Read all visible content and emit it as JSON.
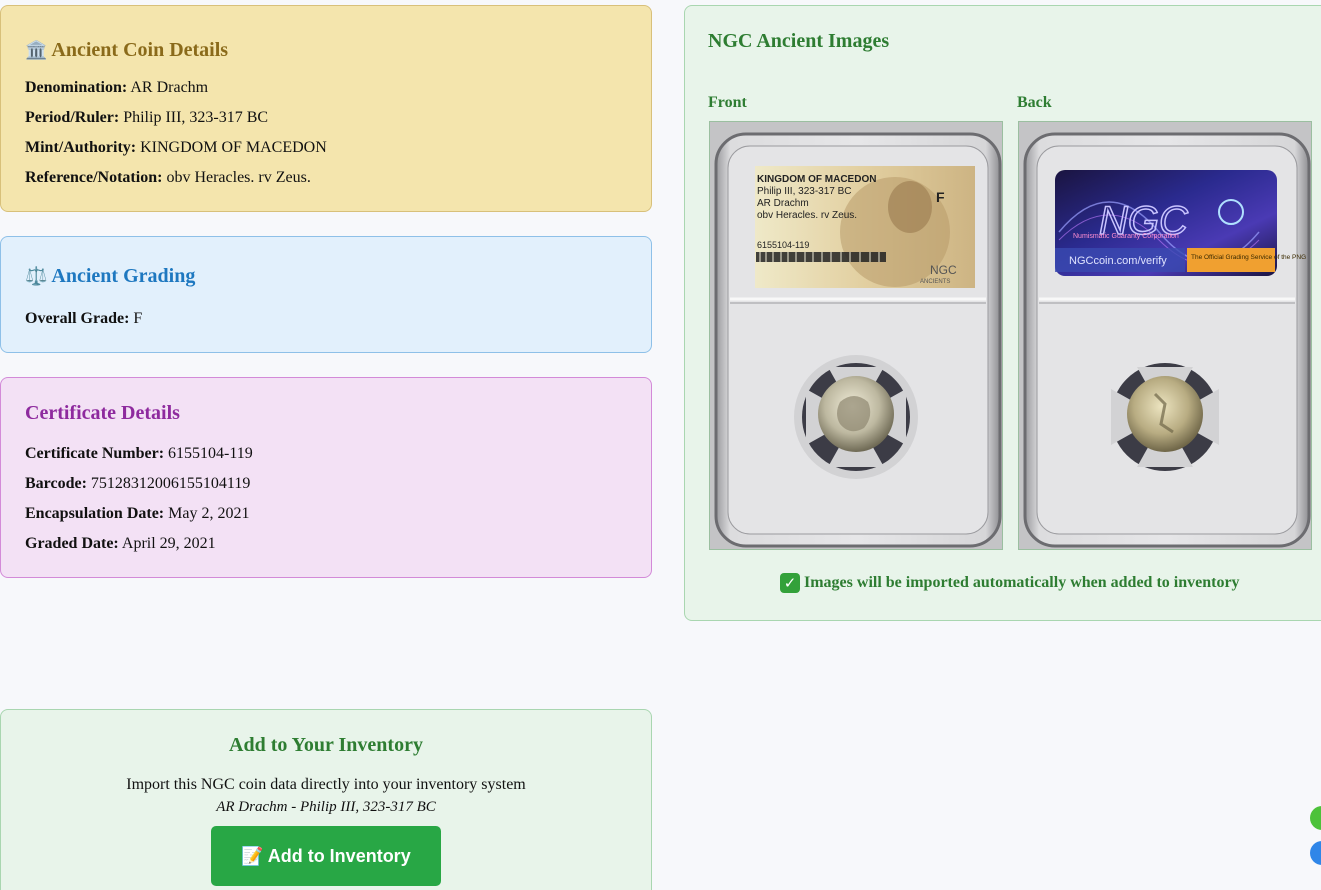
{
  "coin_details": {
    "icon": "classical-building-icon",
    "icon_glyph": "🏛️",
    "title": "Ancient Coin Details",
    "rows": [
      {
        "label": "Denomination:",
        "value": "AR Drachm"
      },
      {
        "label": "Period/Ruler:",
        "value": "Philip III, 323-317 BC"
      },
      {
        "label": "Mint/Authority:",
        "value": "KINGDOM OF MACEDON"
      },
      {
        "label": "Reference/Notation:",
        "value": "obv Heracles. rv Zeus."
      }
    ]
  },
  "grading": {
    "icon": "balance-scale-icon",
    "icon_glyph": "⚖️",
    "title": "Ancient Grading",
    "rows": [
      {
        "label": "Overall Grade:",
        "value": "F"
      }
    ]
  },
  "certificate": {
    "title": "Certificate Details",
    "rows": [
      {
        "label": "Certificate Number:",
        "value": "6155104-119"
      },
      {
        "label": "Barcode:",
        "value": "75128312006155104119"
      },
      {
        "label": "Encapsulation Date:",
        "value": "May 2, 2021"
      },
      {
        "label": "Graded Date:",
        "value": "April 29, 2021"
      }
    ]
  },
  "images": {
    "title": "NGC Ancient Images",
    "front_label": "Front",
    "back_label": "Back",
    "front_slab_label": {
      "line1": "KINGDOM OF MACEDON",
      "line2": "Philip III, 323-317 BC",
      "line3": "AR Drachm",
      "line4": "obv Heracles. rv Zeus.",
      "grade": "F",
      "cert": "6155104-119",
      "brand": "NGC",
      "brand_sub": "ANCIENTS"
    },
    "back_slab_label": {
      "brand": "NGC",
      "tagline": "Numismatic Guaranty Corporation",
      "verify": "NGCcoin.com/verify",
      "official": "The Official Grading Service of the PNG"
    },
    "import_note": "Images will be imported automatically when added to inventory",
    "import_icon": "check-mark-icon"
  },
  "add_inventory": {
    "title": "Add to Your Inventory",
    "description": "Import this NGC coin data directly into your inventory system",
    "subtitle": "AR Drachm - Philip III, 323-317 BC",
    "button_icon": "memo-icon",
    "button_icon_glyph": "📝",
    "button_label": "Add to Inventory"
  },
  "colors": {
    "details_bg": "#f4e5ad",
    "grading_bg": "#e2f0fc",
    "cert_bg": "#f3e1f5",
    "images_bg": "#e8f4ea",
    "button": "#28a745",
    "float_green": "#4cc23a",
    "float_blue": "#2f86e8"
  }
}
